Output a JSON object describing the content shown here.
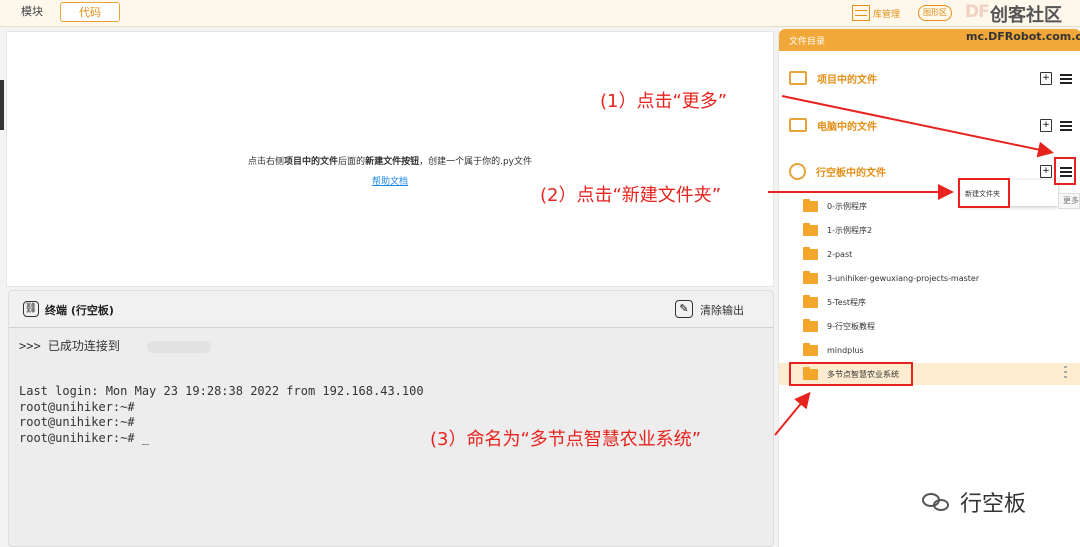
{
  "tabs": {
    "blocks": "模块",
    "code": "代码"
  },
  "header": {
    "library": "库管理",
    "blocks_mode": "图形区",
    "brand_cn": "创客社区",
    "brand_en": "DF",
    "brand_url": "mc.DFRobot.com.cn"
  },
  "editor": {
    "hint_pre": "点击右侧",
    "hint_b1": "项目中的文件",
    "hint_mid": "后面的",
    "hint_b2": "新建文件按钮",
    "hint_post": "，创建一个属于你的.py文件",
    "help": "帮助文档"
  },
  "terminal": {
    "title": "终端 (行空板)",
    "clear": "清除输出",
    "lines": [
      ">>> 已成功连接到",
      "Last login: Mon May 23 19:28:38 2022 from 192.168.43.100",
      "root@unihiker:~#",
      "root@unihiker:~#",
      "root@unihiker:~# _"
    ]
  },
  "sidebar": {
    "title": "文件目录",
    "sections": [
      "项目中的文件",
      "电脑中的文件",
      "行空板中的文件"
    ],
    "folders": [
      "0-示例程序",
      "1-示例程序2",
      "2-past",
      "3-unihiker-gewuxiang-projects-master",
      "5-Test程序",
      "9-行空板教程",
      "mindplus",
      "多节点智慧农业系统"
    ],
    "menu_item": "新建文件夹",
    "more_tip": "更多"
  },
  "annotations": {
    "step1": "(1）点击“更多”",
    "step2": "(2）点击“新建文件夹”",
    "step3": "(3）命名为“多节点智慧农业系统”",
    "watermark": "行空板"
  },
  "colors": {
    "accent": "#e58f16",
    "annotation": "#e8231e",
    "folder": "#f4a62a"
  }
}
